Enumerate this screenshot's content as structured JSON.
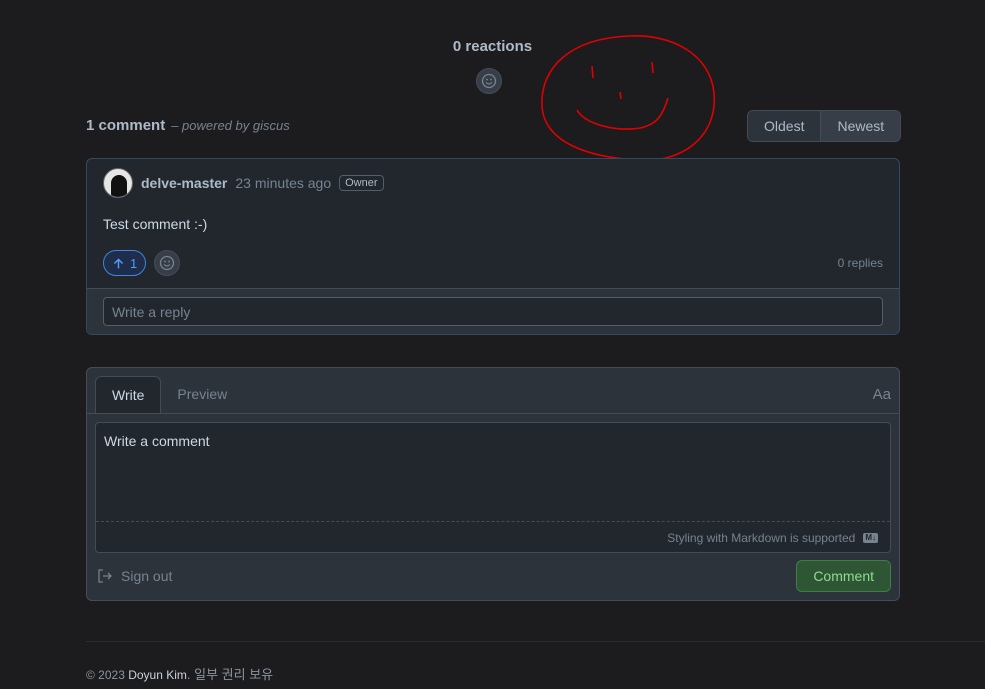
{
  "reactions": {
    "header": "0 reactions",
    "add_icon": "smiley-icon"
  },
  "comments": {
    "count_label": "1 comment",
    "powered_by": "– powered by giscus",
    "sort": {
      "oldest": "Oldest",
      "newest": "Newest",
      "selected": "Newest"
    }
  },
  "comment": {
    "author": "delve-master",
    "time": "23 minutes ago",
    "badge": "Owner",
    "body": "Test comment :-)",
    "upvote_icon": "arrow-up-icon",
    "upvotes": "1",
    "replies": "0 replies",
    "reply_placeholder": "Write a reply"
  },
  "editor": {
    "tabs": [
      "Write",
      "Preview"
    ],
    "active_tab": "Write",
    "font_toggle": "Aa",
    "placeholder": "Write a comment",
    "markdown_hint": "Styling with Markdown is supported",
    "markdown_icon": "M↓",
    "sign_out": "Sign out",
    "submit": "Comment"
  },
  "footer": {
    "copyright": "© 2023",
    "name": "Doyun Kim",
    "rights": ". 일부 권리 보유"
  },
  "colors": {
    "background": "#1c1c1e",
    "accent": "#539bf5",
    "submit": "#2f5634",
    "annotation": "#e00000"
  }
}
